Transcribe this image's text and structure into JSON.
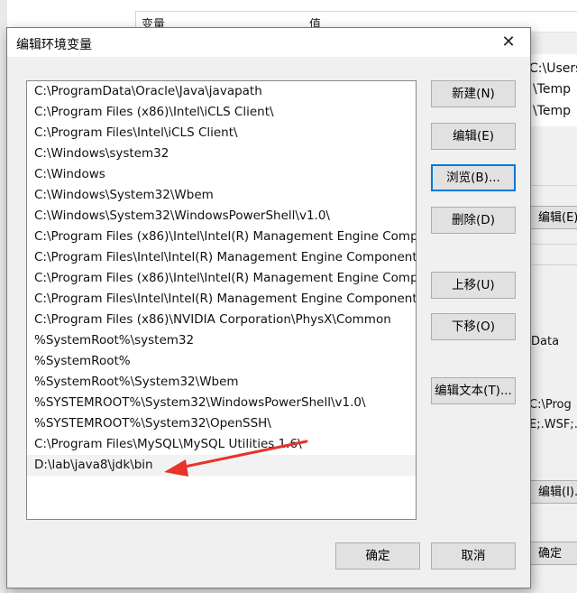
{
  "background": {
    "header": {
      "col_variable": "变量",
      "col_value": "值"
    },
    "list_values": [
      "C:\\Users",
      "\\Temp",
      "\\Temp"
    ],
    "edit_button_label": "编辑(E)",
    "value_snippets": [
      "Data",
      "C:\\Prog",
      "E;.WSF;.W"
    ],
    "edit_button2_label": "编辑(I)...",
    "ok_button_label": "确定"
  },
  "dialog": {
    "title": "编辑环境变量",
    "close_glyph": "✕",
    "paths": [
      "C:\\ProgramData\\Oracle\\Java\\javapath",
      "C:\\Program Files (x86)\\Intel\\iCLS Client\\",
      "C:\\Program Files\\Intel\\iCLS Client\\",
      "C:\\Windows\\system32",
      "C:\\Windows",
      "C:\\Windows\\System32\\Wbem",
      "C:\\Windows\\System32\\WindowsPowerShell\\v1.0\\",
      "C:\\Program Files (x86)\\Intel\\Intel(R) Management Engine Components\\DAL",
      "C:\\Program Files\\Intel\\Intel(R) Management Engine Components\\DAL",
      "C:\\Program Files (x86)\\Intel\\Intel(R) Management Engine Components\\IPT",
      "C:\\Program Files\\Intel\\Intel(R) Management Engine Components\\IPT",
      "C:\\Program Files (x86)\\NVIDIA Corporation\\PhysX\\Common",
      "%SystemRoot%\\system32",
      "%SystemRoot%",
      "%SystemRoot%\\System32\\Wbem",
      "%SYSTEMROOT%\\System32\\WindowsPowerShell\\v1.0\\",
      "%SYSTEMROOT%\\System32\\OpenSSH\\",
      "C:\\Program Files\\MySQL\\MySQL Utilities 1.6\\",
      "D:\\lab\\java8\\jdk\\bin"
    ],
    "buttons": {
      "new": "新建(N)",
      "edit": "编辑(E)",
      "browse": "浏览(B)...",
      "delete": "删除(D)",
      "move_up": "上移(U)",
      "move_down": "下移(O)",
      "edit_text": "编辑文本(T)...",
      "ok": "确定",
      "cancel": "取消"
    },
    "annotation_color": "#e8322a"
  }
}
